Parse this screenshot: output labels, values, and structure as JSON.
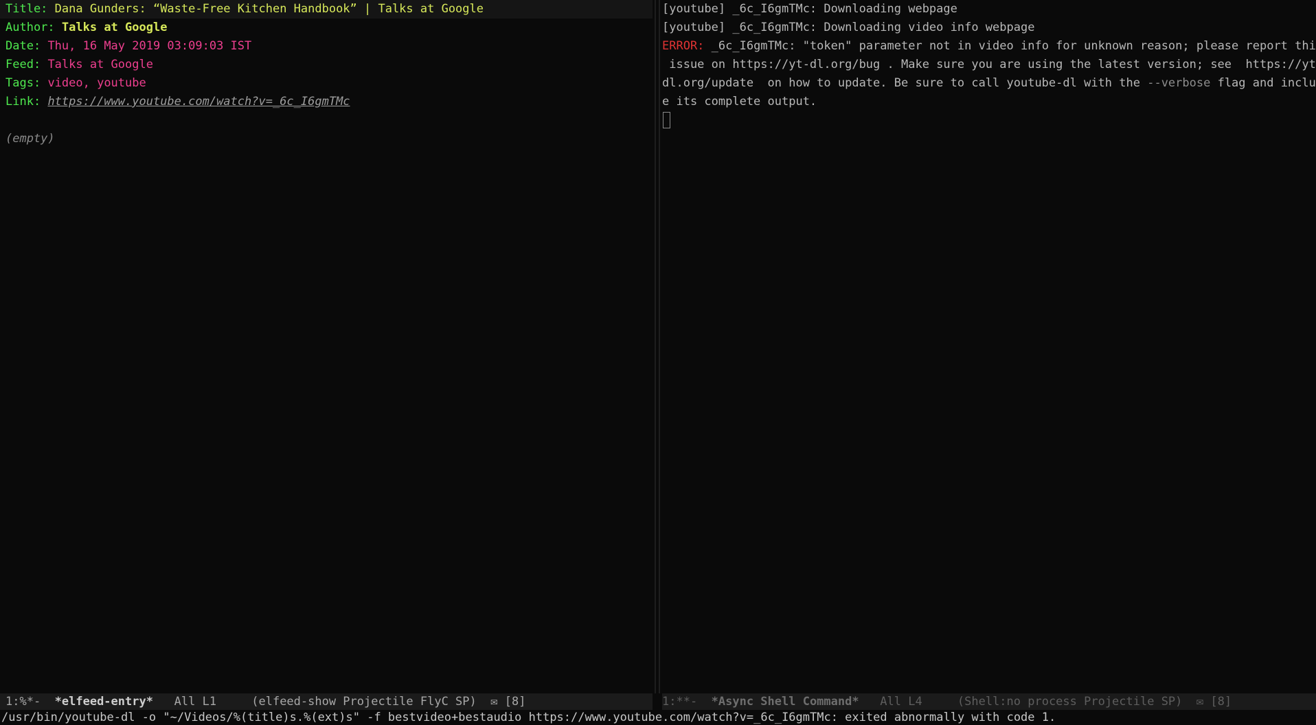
{
  "left_pane": {
    "title_key": "Title:",
    "title_value": "Dana Gunders: “Waste-Free Kitchen Handbook” | Talks at Google",
    "author_key": "Author:",
    "author_value": "Talks at Google",
    "date_key": "Date:",
    "date_value": "Thu, 16 May 2019 03:09:03 IST",
    "feed_key": "Feed:",
    "feed_value": "Talks at Google",
    "tags_key": "Tags:",
    "tags_value": "video, youtube",
    "link_key": "Link:",
    "link_value": "https://www.youtube.com/watch?v=_6c_I6gmTMc",
    "body": "(empty)"
  },
  "right_pane": {
    "line1": "[youtube] _6c_I6gmTMc: Downloading webpage",
    "line2": "[youtube] _6c_I6gmTMc: Downloading video info webpage",
    "error_label": "ERROR:",
    "error_line1_rest": " _6c_I6gmTMc: \"token\" parameter not in video info for unknown reason; please report this",
    "error_line2": " issue on https://yt-dl.org/bug . Make sure you are using the latest version; see  https://yt-",
    "error_line3_pre": "dl.org/update  on how to update. Be sure to call youtube-dl with the ",
    "error_line3_flag": "--verbose",
    "error_line3_post": " flag and includ",
    "error_line4": "e its complete output."
  },
  "modeline_left": {
    "state": "1:%*-  ",
    "buffer": "*elfeed-entry*",
    "position": "   All L1     ",
    "modes": "(elfeed-show Projectile FlyC SP)",
    "mail_icon": "✉",
    "mail_count": " [8]"
  },
  "modeline_right": {
    "state": "1:**-  ",
    "buffer": "*Async Shell Command*",
    "position": "   All L4     ",
    "modes": "(Shell:no process Projectile SP)",
    "mail_icon": "✉",
    "mail_count": " [8]"
  },
  "echo_area": "/usr/bin/youtube-dl -o \"~/Videos/%(title)s.%(ext)s\" -f bestvideo+bestaudio https://www.youtube.com/watch?v=_6c_I6gmTMc: exited abnormally with code 1.",
  "colors": {
    "background": "#0a0a0a",
    "key": "#4ee84e",
    "title": "#d7e85a",
    "date": "#ee3f8f",
    "error": "#e03333"
  }
}
